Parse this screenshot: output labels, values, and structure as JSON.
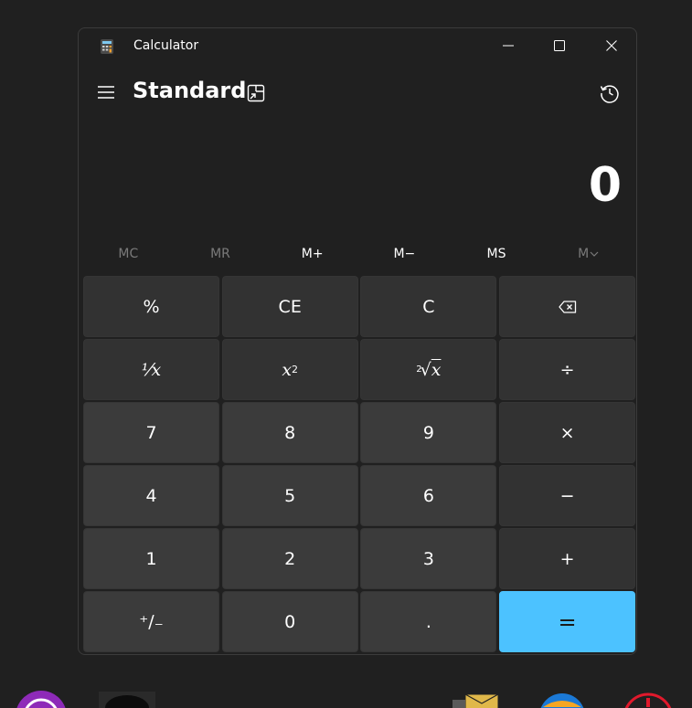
{
  "window": {
    "title": "Calculator",
    "controls": {
      "minimize": "minimize-icon",
      "maximize": "maximize-icon",
      "close": "close-icon"
    }
  },
  "header": {
    "mode": "Standard",
    "icons": {
      "menu": "hamburger-icon",
      "keep_on_top": "keep-on-top-icon",
      "history": "history-icon"
    }
  },
  "display": {
    "value": "0"
  },
  "memory": {
    "mc": "MC",
    "mr": "MR",
    "mplus": "M+",
    "mminus": "M−",
    "ms": "MS",
    "mlist": "M"
  },
  "keys": {
    "percent": "%",
    "ce": "CE",
    "c": "C",
    "backspace_icon": "backspace-icon",
    "reciprocal": "⅟x",
    "square_base": "x",
    "square_exp": "2",
    "sqrt_index": "2",
    "sqrt_base": "x",
    "divide": "÷",
    "seven": "7",
    "eight": "8",
    "nine": "9",
    "multiply": "×",
    "four": "4",
    "five": "5",
    "six": "6",
    "minus": "−",
    "one": "1",
    "two": "2",
    "three": "3",
    "plus": "+",
    "negate": "⁺∕₋",
    "zero": "0",
    "decimal": ".",
    "equals": "="
  },
  "colors": {
    "background": "#202020",
    "key_number": "#3b3b3b",
    "key_function": "#323232",
    "accent": "#4cc2ff"
  }
}
